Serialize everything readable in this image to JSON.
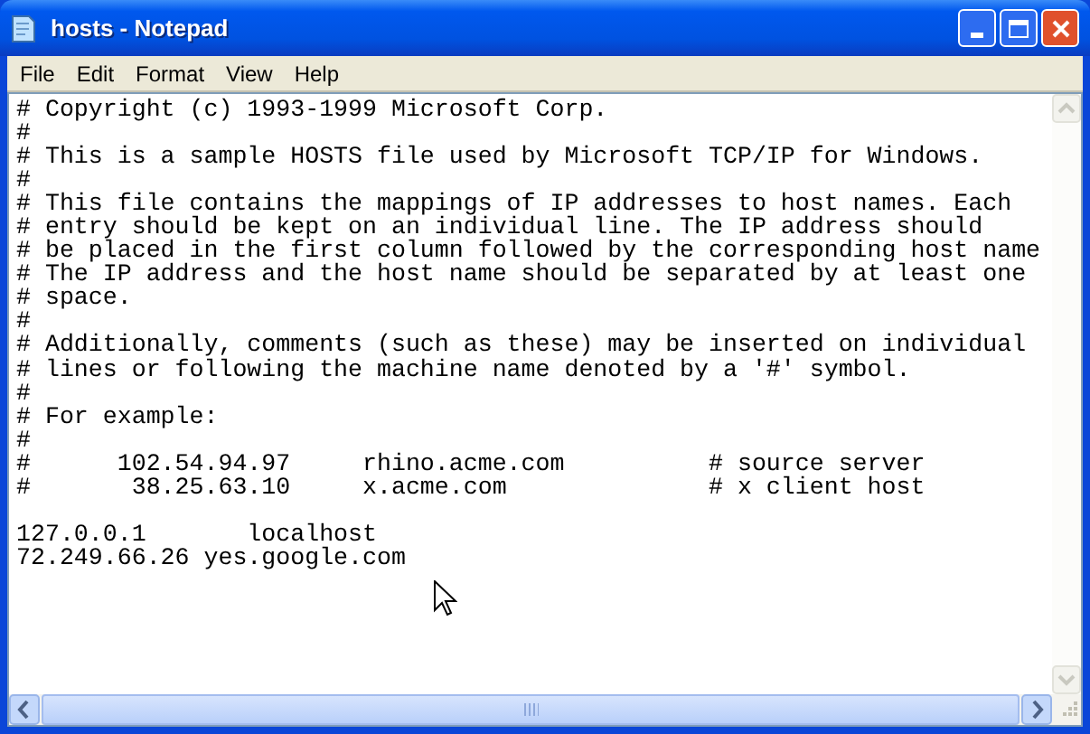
{
  "window": {
    "title": "hosts - Notepad"
  },
  "menu": [
    {
      "label": "File"
    },
    {
      "label": "Edit"
    },
    {
      "label": "Format"
    },
    {
      "label": "View"
    },
    {
      "label": "Help"
    }
  ],
  "document": {
    "text": "# Copyright (c) 1993-1999 Microsoft Corp.\n#\n# This is a sample HOSTS file used by Microsoft TCP/IP for Windows.\n#\n# This file contains the mappings of IP addresses to host names. Each\n# entry should be kept on an individual line. The IP address should\n# be placed in the first column followed by the corresponding host name\n# The IP address and the host name should be separated by at least one\n# space.\n#\n# Additionally, comments (such as these) may be inserted on individual\n# lines or following the machine name denoted by a '#' symbol.\n#\n# For example:\n#\n#      102.54.94.97     rhino.acme.com          # source server\n#       38.25.63.10     x.acme.com              # x client host\n\n127.0.0.1       localhost\n72.249.66.26 yes.google.com"
  }
}
